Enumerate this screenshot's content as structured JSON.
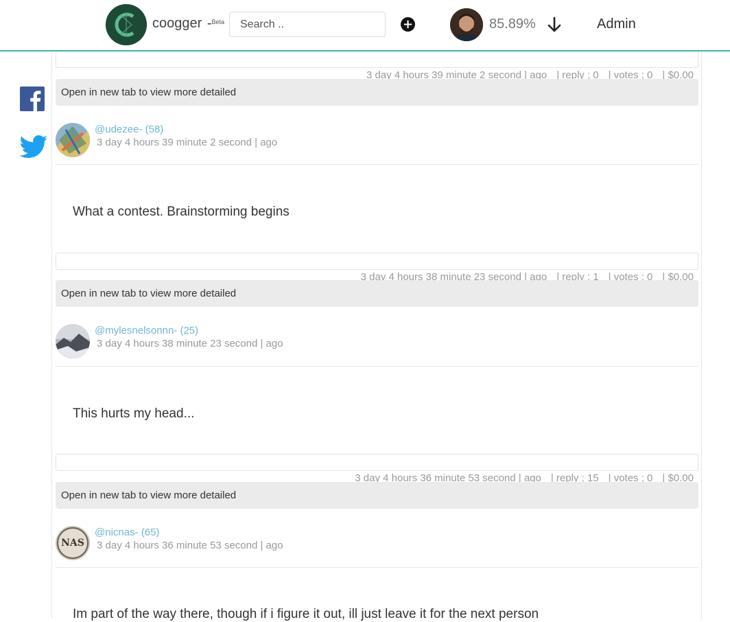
{
  "header": {
    "brand": "coogger",
    "brand_dash": "-",
    "beta": "Beta",
    "search_placeholder": "Search ..",
    "percent": "85.89%",
    "admin": "Admin",
    "accent": "#3bb99d"
  },
  "social": {
    "facebook_icon": "facebook-icon",
    "twitter_icon": "twitter-icon"
  },
  "first_meta": {
    "time": "3 day 4 hours 39 minute 2 second | ago",
    "reply": "| reply ; 0",
    "votes": "| votes ; 0",
    "payout": "| $0.00"
  },
  "posts": [
    {
      "open_text": "Open in new tab to view more detailed",
      "author": "@udezee- (58)",
      "time": "3 day 4 hours 39 minute 2 second | ago",
      "body": "What a contest. Brainstorming begins",
      "meta": {
        "time": "3 day 4 hours 38 minute 23 second | ago",
        "reply": "| reply ; 1",
        "votes": "| votes ; 0",
        "payout": "| $0.00"
      }
    },
    {
      "open_text": "Open in new tab to view more detailed",
      "author": "@mylesnelsonnn- (25)",
      "time": "3 day 4 hours 38 minute 23 second | ago",
      "body": "This hurts my head...",
      "meta": {
        "time": "3 day 4 hours 36 minute 53 second | ago",
        "reply": "| reply ; 15",
        "votes": "| votes ; 0",
        "payout": "| $0.00"
      }
    },
    {
      "open_text": "Open in new tab to view more detailed",
      "author": "@nicnas- (65)",
      "time": "3 day 4 hours 36 minute 53 second | ago",
      "body": "Im part of the way there, though if i figure it out, ill just leave it for the next person"
    }
  ]
}
